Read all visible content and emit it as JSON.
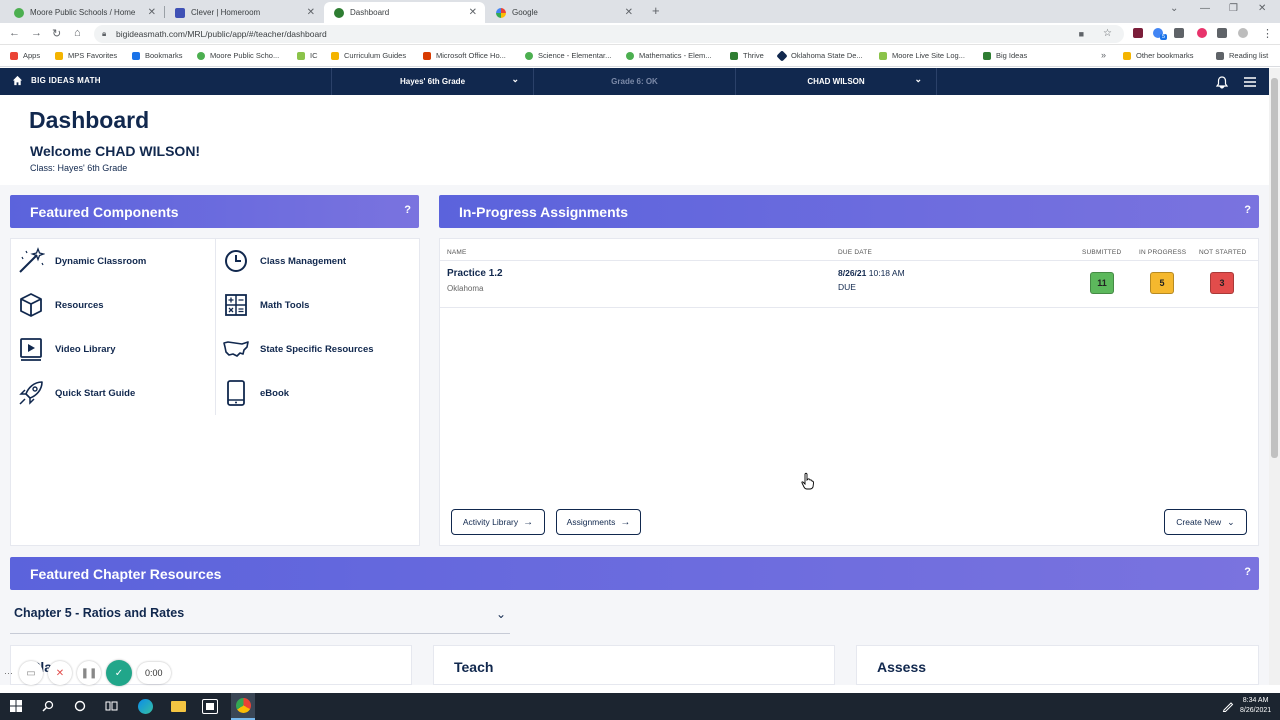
{
  "browser": {
    "tabs": [
      {
        "label": "Moore Public Schools / Home",
        "color": "#4caf50"
      },
      {
        "label": "Clever | Homeroom",
        "color": "#3f51b5"
      },
      {
        "label": "Dashboard",
        "color": "#2e7d32"
      },
      {
        "label": "Google",
        "color": "#4285f4"
      }
    ],
    "url": "bigideasmath.com/MRL/public/app/#/teacher/dashboard",
    "bookmarks": [
      {
        "label": "Apps"
      },
      {
        "label": "MPS Favorites"
      },
      {
        "label": "Bookmarks"
      },
      {
        "label": "Moore Public Scho..."
      },
      {
        "label": "IC"
      },
      {
        "label": "Curriculum Guides"
      },
      {
        "label": "Microsoft Office Ho..."
      },
      {
        "label": "Science - Elementar..."
      },
      {
        "label": "Mathematics - Elem..."
      },
      {
        "label": "Thrive"
      },
      {
        "label": "Oklahoma State De..."
      },
      {
        "label": "Moore Live Site Log..."
      },
      {
        "label": "Big Ideas"
      },
      {
        "label": "Other bookmarks"
      },
      {
        "label": "Reading list"
      }
    ],
    "ext_badge": "5"
  },
  "nav": {
    "logo": "BIG IDEAS MATH",
    "class_select": "Hayes' 6th Grade",
    "grade": "Grade 6: OK",
    "user": "CHAD WILSON"
  },
  "header": {
    "title": "Dashboard",
    "welcome": "Welcome CHAD WILSON!",
    "class_line": "Class: Hayes' 6th Grade"
  },
  "featured": {
    "title": "Featured Components",
    "help": "?",
    "items": [
      {
        "label": "Dynamic Classroom",
        "icon": "wand-icon"
      },
      {
        "label": "Class Management",
        "icon": "clock-icon"
      },
      {
        "label": "Resources",
        "icon": "cube-icon"
      },
      {
        "label": "Math Tools",
        "icon": "calculator-icon"
      },
      {
        "label": "Video Library",
        "icon": "video-icon"
      },
      {
        "label": "State Specific Resources",
        "icon": "usa-map-icon"
      },
      {
        "label": "Quick Start Guide",
        "icon": "rocket-icon"
      },
      {
        "label": "eBook",
        "icon": "tablet-icon"
      }
    ]
  },
  "assignments": {
    "title": "In-Progress Assignments",
    "help": "?",
    "columns": {
      "name": "NAME",
      "due": "DUE DATE",
      "submitted": "SUBMITTED",
      "in_progress": "IN PROGRESS",
      "not_started": "NOT STARTED"
    },
    "rows": [
      {
        "name": "Practice 1.2",
        "sub": "Oklahoma",
        "due_date": "8/26/21",
        "due_time": "10:18 AM",
        "status": "DUE",
        "submitted": "11",
        "in_progress": "5",
        "not_started": "3"
      }
    ],
    "colors": {
      "submitted": "#5cb85c",
      "in_progress": "#f5b82e",
      "not_started": "#e24c4b"
    },
    "buttons": {
      "activity_library": "Activity Library",
      "assignments": "Assignments",
      "create_new": "Create New"
    }
  },
  "chapter": {
    "title": "Featured Chapter Resources",
    "help": "?",
    "select": "Chapter 5 - Ratios and Rates",
    "cards": [
      "Plan",
      "Teach",
      "Assess"
    ]
  },
  "recorder": {
    "time": "0:00"
  },
  "taskbar": {
    "time": "8:34 AM",
    "date": "8/26/2021"
  }
}
